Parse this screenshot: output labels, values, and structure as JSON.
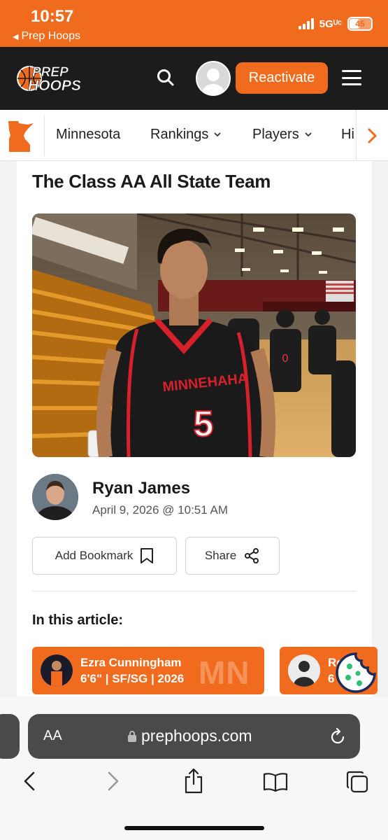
{
  "status_bar": {
    "time": "10:57",
    "back_app": "Prep Hoops",
    "network": "5Gᵁᶜ",
    "battery": "45",
    "battery_level": 0.45
  },
  "header": {
    "logo_line1": "PREP",
    "logo_line2": "HOOPS",
    "reactivate_label": "Reactivate",
    "icons": {
      "search": "search-icon",
      "avatar": "user-avatar",
      "menu": "hamburger-menu-icon"
    }
  },
  "nav": {
    "items": [
      {
        "label": "Minnesota",
        "has_dropdown": false
      },
      {
        "label": "Rankings",
        "has_dropdown": true
      },
      {
        "label": "Players",
        "has_dropdown": true
      },
      {
        "label": "Hi",
        "has_dropdown": false
      }
    ],
    "state_icon": "minnesota-state-icon",
    "scroll_icon": "chevron-right-icon"
  },
  "article": {
    "title": "The Class AA All State Team",
    "author_name": "Ryan James",
    "date": "April 9, 2026 @ 10:51 AM",
    "bookmark_label": "Add Bookmark",
    "share_label": "Share",
    "in_article_heading": "In this article:",
    "photo": {
      "jersey_team": "MINNEHAHA",
      "jersey_number": "5"
    },
    "players": [
      {
        "name": "Ezra Cunningham",
        "info": "6'6\" | SF/SG | 2026",
        "state": "MN"
      },
      {
        "name": "Ro",
        "info": "6"
      }
    ]
  },
  "browser": {
    "text_size_label": "AA",
    "url": "prephoops.com"
  },
  "colors": {
    "brand_orange": "#f06b1d",
    "header_dark": "#1c1c1c",
    "url_bar": "#4a4a4a"
  }
}
